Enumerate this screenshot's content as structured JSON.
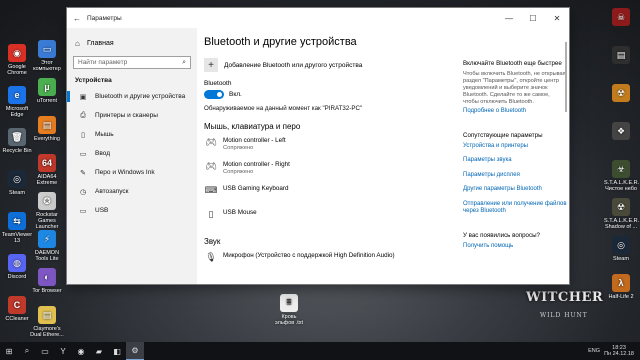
{
  "window": {
    "title": "Параметры",
    "back_glyph": "←",
    "controls": {
      "minimize": "—",
      "maximize": "☐",
      "close": "✕"
    }
  },
  "sidebar": {
    "home": {
      "label": "Главная",
      "glyph": "⌂"
    },
    "search_placeholder": "Найти параметр",
    "search_glyph": "⌕",
    "section_title": "Устройства",
    "items": [
      {
        "label": "Bluetooth и другие устройства",
        "icon": "bluetooth-icon",
        "glyph": "▣",
        "active": true
      },
      {
        "label": "Принтеры и сканеры",
        "icon": "printer-icon",
        "glyph": "⎙",
        "active": false
      },
      {
        "label": "Мышь",
        "icon": "mouse-icon",
        "glyph": "▯",
        "active": false
      },
      {
        "label": "Ввод",
        "icon": "keyboard-icon",
        "glyph": "▭",
        "active": false
      },
      {
        "label": "Перо и Windows Ink",
        "icon": "pen-icon",
        "glyph": "✎",
        "active": false
      },
      {
        "label": "Автозапуск",
        "icon": "autoplay-icon",
        "glyph": "◷",
        "active": false
      },
      {
        "label": "USB",
        "icon": "usb-icon",
        "glyph": "▭",
        "active": false
      }
    ]
  },
  "main": {
    "title": "Bluetooth и другие устройства",
    "add_device_label": "Добавление Bluetooth или другого устройства",
    "add_glyph": "+",
    "bluetooth_label": "Bluetooth",
    "toggle_state": "Вкл.",
    "discoverable_text": "Обнаруживаемое на данный момент как \"PIRAT32-PC\"",
    "section_mouse": "Мышь, клавиатура и перо",
    "devices": [
      {
        "name": "Motion controller - Left",
        "status": "Сопряжено",
        "icon": "gamepad-icon",
        "glyph": "🎮︎"
      },
      {
        "name": "Motion controller - Right",
        "status": "Сопряжено",
        "icon": "gamepad-icon",
        "glyph": "🎮︎"
      },
      {
        "name": "USB Gaming Keyboard",
        "status": "",
        "icon": "keyboard-icon",
        "glyph": "⌨"
      },
      {
        "name": "USB Mouse",
        "status": "",
        "icon": "mouse-icon",
        "glyph": "▯"
      }
    ],
    "section_audio": "Звук",
    "audio_devices": [
      {
        "name": "Микрофон (Устройство с поддержкой High Definition Audio)",
        "icon": "microphone-icon",
        "glyph": "🎙︎"
      }
    ]
  },
  "right_panel": {
    "swift_pair_title": "Включайте Bluetooth еще быстрее",
    "swift_pair_text": "Чтобы включить Bluetooth, не открывая раздел \"Параметры\", откройте центр уведомлений и выберите значок Bluetooth. Сделайте то же самое, чтобы отключить Bluetooth.",
    "more_link": "Подробнее о Bluetooth",
    "related_title": "Сопутствующие параметры",
    "related_links": [
      "Устройства и принтеры",
      "Параметры звука",
      "Параметры дисплея",
      "Другие параметры Bluetooth",
      "Отправление или получение файлов через Bluetooth"
    ],
    "question_title": "У вас появились вопросы?",
    "help_link": "Получить помощь"
  },
  "desktop": {
    "left_icons": [
      {
        "label": "Google Chrome",
        "color": "#d93025",
        "glyph": "◉"
      },
      {
        "label": "Microsoft Edge",
        "color": "#1a73e8",
        "glyph": "e"
      },
      {
        "label": "Recycle Bin",
        "color": "#5b6770",
        "glyph": "🗑︎"
      },
      {
        "label": "Steam",
        "color": "#1b2838",
        "glyph": "◎"
      },
      {
        "label": "TeamViewer 13",
        "color": "#0e6fd8",
        "glyph": "⇆"
      },
      {
        "label": "Discord",
        "color": "#5865f2",
        "glyph": "◍"
      },
      {
        "label": "CCleaner",
        "color": "#c0392b",
        "glyph": "C"
      }
    ],
    "left_icons_col2": [
      {
        "label": "Этот компьютер",
        "color": "#3a7bd5",
        "glyph": "▭"
      },
      {
        "label": "uTorrent",
        "color": "#4caf50",
        "glyph": "µ"
      },
      {
        "label": "Everything",
        "color": "#e67e22",
        "glyph": "▤"
      },
      {
        "label": "AIDA64 Extreme",
        "color": "#c0392b",
        "glyph": "64"
      },
      {
        "label": "Rockstar Games Launcher",
        "color": "#ccc",
        "glyph": "✪"
      },
      {
        "label": "DAEMON Tools Lite",
        "color": "#1e88e5",
        "glyph": "⚡"
      },
      {
        "label": "Tor Browser",
        "color": "#7e57c2",
        "glyph": "◐"
      },
      {
        "label": "Claymore's Dual Ethere...",
        "color": "#e0c050",
        "glyph": "▤"
      }
    ],
    "right_icons": [
      {
        "label": "",
        "color": "#8e1b1b",
        "glyph": "☠"
      },
      {
        "label": "",
        "color": "#2e2e2e",
        "glyph": "▤"
      },
      {
        "label": "",
        "color": "#c27c1d",
        "glyph": "☢"
      },
      {
        "label": "",
        "color": "#444",
        "glyph": "❖"
      },
      {
        "label": "S.T.A.L.K.E.R. Чистое небо",
        "color": "#3d4d2f",
        "glyph": "☣"
      },
      {
        "label": "S.T.A.L.K.E.R. Shadow of ...",
        "color": "#4a4a3a",
        "glyph": "☢"
      },
      {
        "label": "Steam",
        "color": "#1b2838",
        "glyph": "◎"
      },
      {
        "label": "Half-Life 2",
        "color": "#c26a1d",
        "glyph": "λ"
      }
    ],
    "center_file": "Кровь эльфов .txt",
    "witcher_logo": "WITCHER",
    "witcher_sub": "WILD HUNT"
  },
  "taskbar": {
    "start_glyph": "⊞",
    "apps": [
      {
        "name": "search",
        "glyph": "⌕"
      },
      {
        "name": "task-view",
        "glyph": "▭"
      },
      {
        "name": "yandex",
        "glyph": "Y"
      },
      {
        "name": "chrome",
        "glyph": "◉"
      },
      {
        "name": "file-explorer",
        "glyph": "▰"
      },
      {
        "name": "store",
        "glyph": "◧"
      },
      {
        "name": "settings",
        "glyph": "⚙",
        "active": true
      }
    ],
    "language": "ENG",
    "time": "18:23",
    "date": "Пн 24.12.18"
  }
}
